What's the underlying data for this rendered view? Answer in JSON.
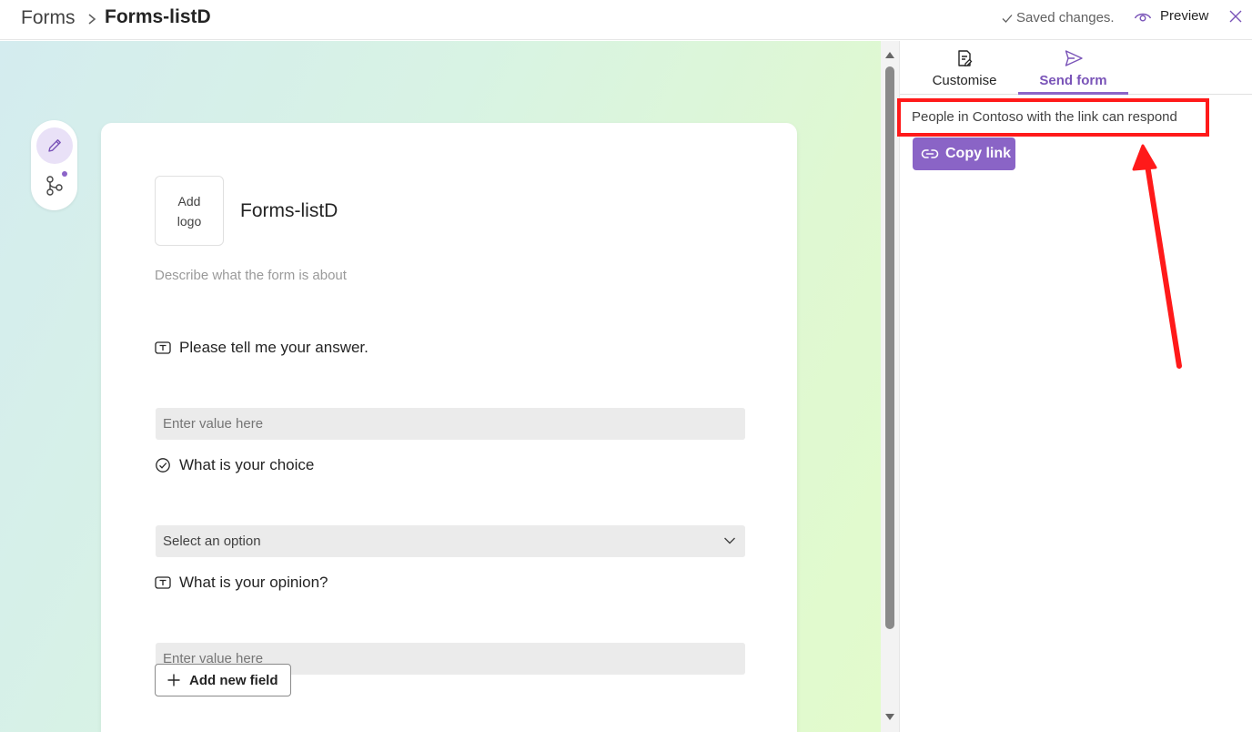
{
  "header": {
    "breadcrumb_root": "Forms",
    "breadcrumb_current": "Forms-listD",
    "saved_status": "Saved changes.",
    "preview_label": "Preview"
  },
  "form": {
    "logo_placeholder_line1": "Add",
    "logo_placeholder_line2": "logo",
    "title": "Forms-listD",
    "description_placeholder": "Describe what the form is about",
    "questions": [
      {
        "label": "Please tell me your answer.",
        "type": "text",
        "placeholder": "Enter value here",
        "icon": "text-field-icon"
      },
      {
        "label": "What is your choice",
        "type": "choice",
        "placeholder": "Select an option",
        "icon": "choice-check-icon"
      },
      {
        "label": "What is your opinion?",
        "type": "text",
        "placeholder": "Enter value here",
        "icon": "text-field-icon"
      }
    ],
    "add_field_label": "Add new field"
  },
  "panel": {
    "tabs": [
      {
        "label": "Customise",
        "icon": "customise-icon",
        "active": false
      },
      {
        "label": "Send form",
        "icon": "send-icon",
        "active": true
      }
    ],
    "access_text": "People in Contoso with the link can respond",
    "copy_link_label": "Copy link"
  },
  "colors": {
    "accent": "#8a64c6",
    "annotation": "#ff1a1a",
    "canvas_start": "#d4ecef",
    "canvas_end": "#e2fbcc"
  }
}
